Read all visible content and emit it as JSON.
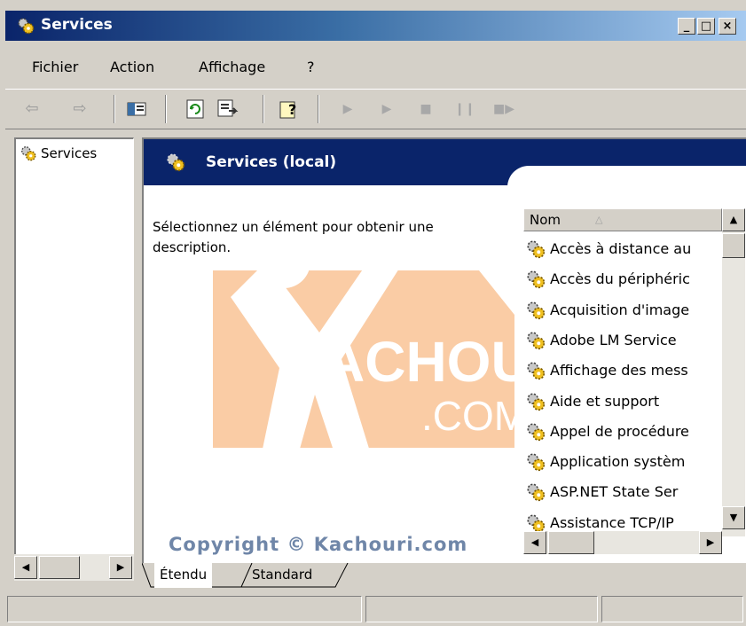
{
  "window": {
    "title": "Services",
    "minimize": "_",
    "maximize": "□",
    "close": "×"
  },
  "menu": [
    "Fichier",
    "Action",
    "Affichage",
    "?"
  ],
  "toolbar": {
    "icons": [
      "back-arrow-icon",
      "forward-arrow-icon",
      "show-hide-tree-icon",
      "refresh-icon",
      "export-list-icon",
      "help-icon",
      "start-icon",
      "start-disabled-icon",
      "stop-icon",
      "pause-icon",
      "restart-icon"
    ]
  },
  "tree": {
    "items": [
      {
        "label": "Services",
        "icon": "services-gear-icon"
      }
    ]
  },
  "right_pane": {
    "header_title": "Services (local)",
    "description": "Sélectionnez un élément pour obtenir une description."
  },
  "list": {
    "column": "Nom",
    "sort_indicator": "△",
    "rows": [
      "Accès à distance au",
      "Accès du périphéric",
      "Acquisition d'image",
      "Adobe LM Service",
      "Affichage des mess",
      "Aide et support",
      "Appel de procédure",
      "Application systèm",
      "ASP.NET State Ser",
      "Assistance TCP/IP"
    ]
  },
  "tabs": [
    "Étendu",
    "Standard"
  ],
  "watermark": {
    "text_main": "ACHOURI",
    "text_sub": ".COM",
    "copyright": "Copyright © Kachouri.com"
  },
  "colors": {
    "title_gradient_start": "#0a246a",
    "title_gradient_end": "#a6caf0",
    "panel_header": "#0a246a",
    "watermark_orange": "#f7a35c"
  }
}
